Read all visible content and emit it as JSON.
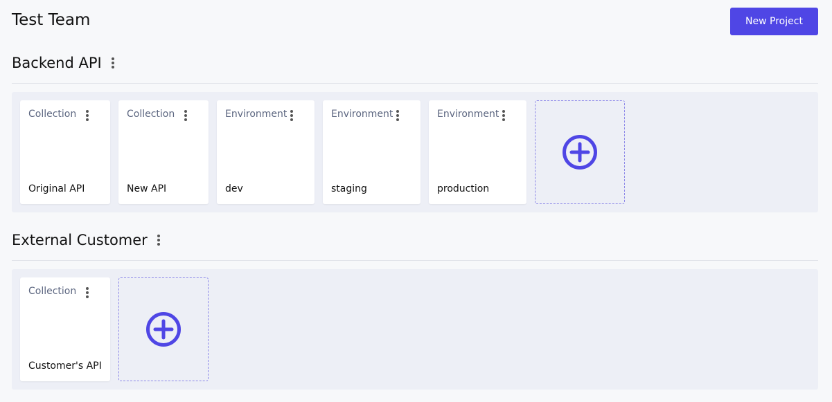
{
  "header": {
    "title": "Test Team",
    "new_project_label": "New Project"
  },
  "projects": [
    {
      "name": "Backend API",
      "items": [
        {
          "type": "Collection",
          "name": "Original API"
        },
        {
          "type": "Collection",
          "name": "New API"
        },
        {
          "type": "Environment",
          "name": "dev"
        },
        {
          "type": "Environment",
          "name": "staging"
        },
        {
          "type": "Environment",
          "name": "production"
        }
      ]
    },
    {
      "name": "External Customer",
      "items": [
        {
          "type": "Collection",
          "name": "Customer's API"
        }
      ]
    }
  ],
  "colors": {
    "accent": "#4f46e5",
    "cards_area_background": "#edeff6",
    "page_background": "#f7f8fa"
  },
  "icons": {
    "menu": "kebab-menu-icon",
    "add": "plus-circle-icon"
  }
}
